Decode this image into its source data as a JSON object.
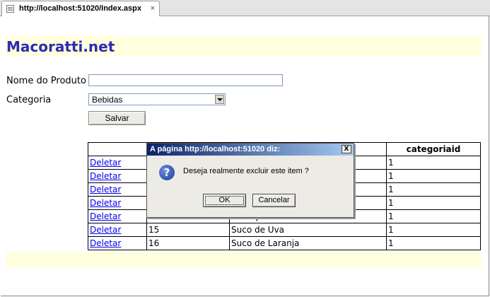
{
  "browser": {
    "tab_title": "http://localhost:51020/Index.aspx",
    "close_glyph": "×"
  },
  "site": {
    "title": "Macoratti.net"
  },
  "form": {
    "name_label": "Nome do Produto",
    "name_value": "",
    "category_label": "Categoria",
    "category_value": "Bebidas",
    "save_label": "Salvar"
  },
  "table": {
    "headers": [
      "",
      "",
      "",
      "categoriaid"
    ],
    "rows": [
      {
        "action": "Deletar",
        "id": "",
        "name": "",
        "categoriaid": "1"
      },
      {
        "action": "Deletar",
        "id": "",
        "name": "",
        "categoriaid": "1"
      },
      {
        "action": "Deletar",
        "id": "",
        "name": "",
        "categoriaid": "1"
      },
      {
        "action": "Deletar",
        "id": "",
        "name": "",
        "categoriaid": "1"
      },
      {
        "action": "Deletar",
        "id": "13",
        "name": "Cerveja",
        "categoriaid": "1"
      },
      {
        "action": "Deletar",
        "id": "15",
        "name": "Suco de Uva",
        "categoriaid": "1"
      },
      {
        "action": "Deletar",
        "id": "16",
        "name": "Suco de Laranja",
        "categoriaid": "1"
      }
    ]
  },
  "dialog": {
    "title": "A página http://localhost:51020 diz:",
    "message": "Deseja realmente excluir este item ?",
    "ok_label": "OK",
    "cancel_label": "Cancelar",
    "close_glyph": "X",
    "icon": "question-icon",
    "icon_glyph": "?"
  },
  "colors": {
    "title": "#2b2bb5",
    "band": "#ffffdd",
    "link": "#0000ee"
  }
}
